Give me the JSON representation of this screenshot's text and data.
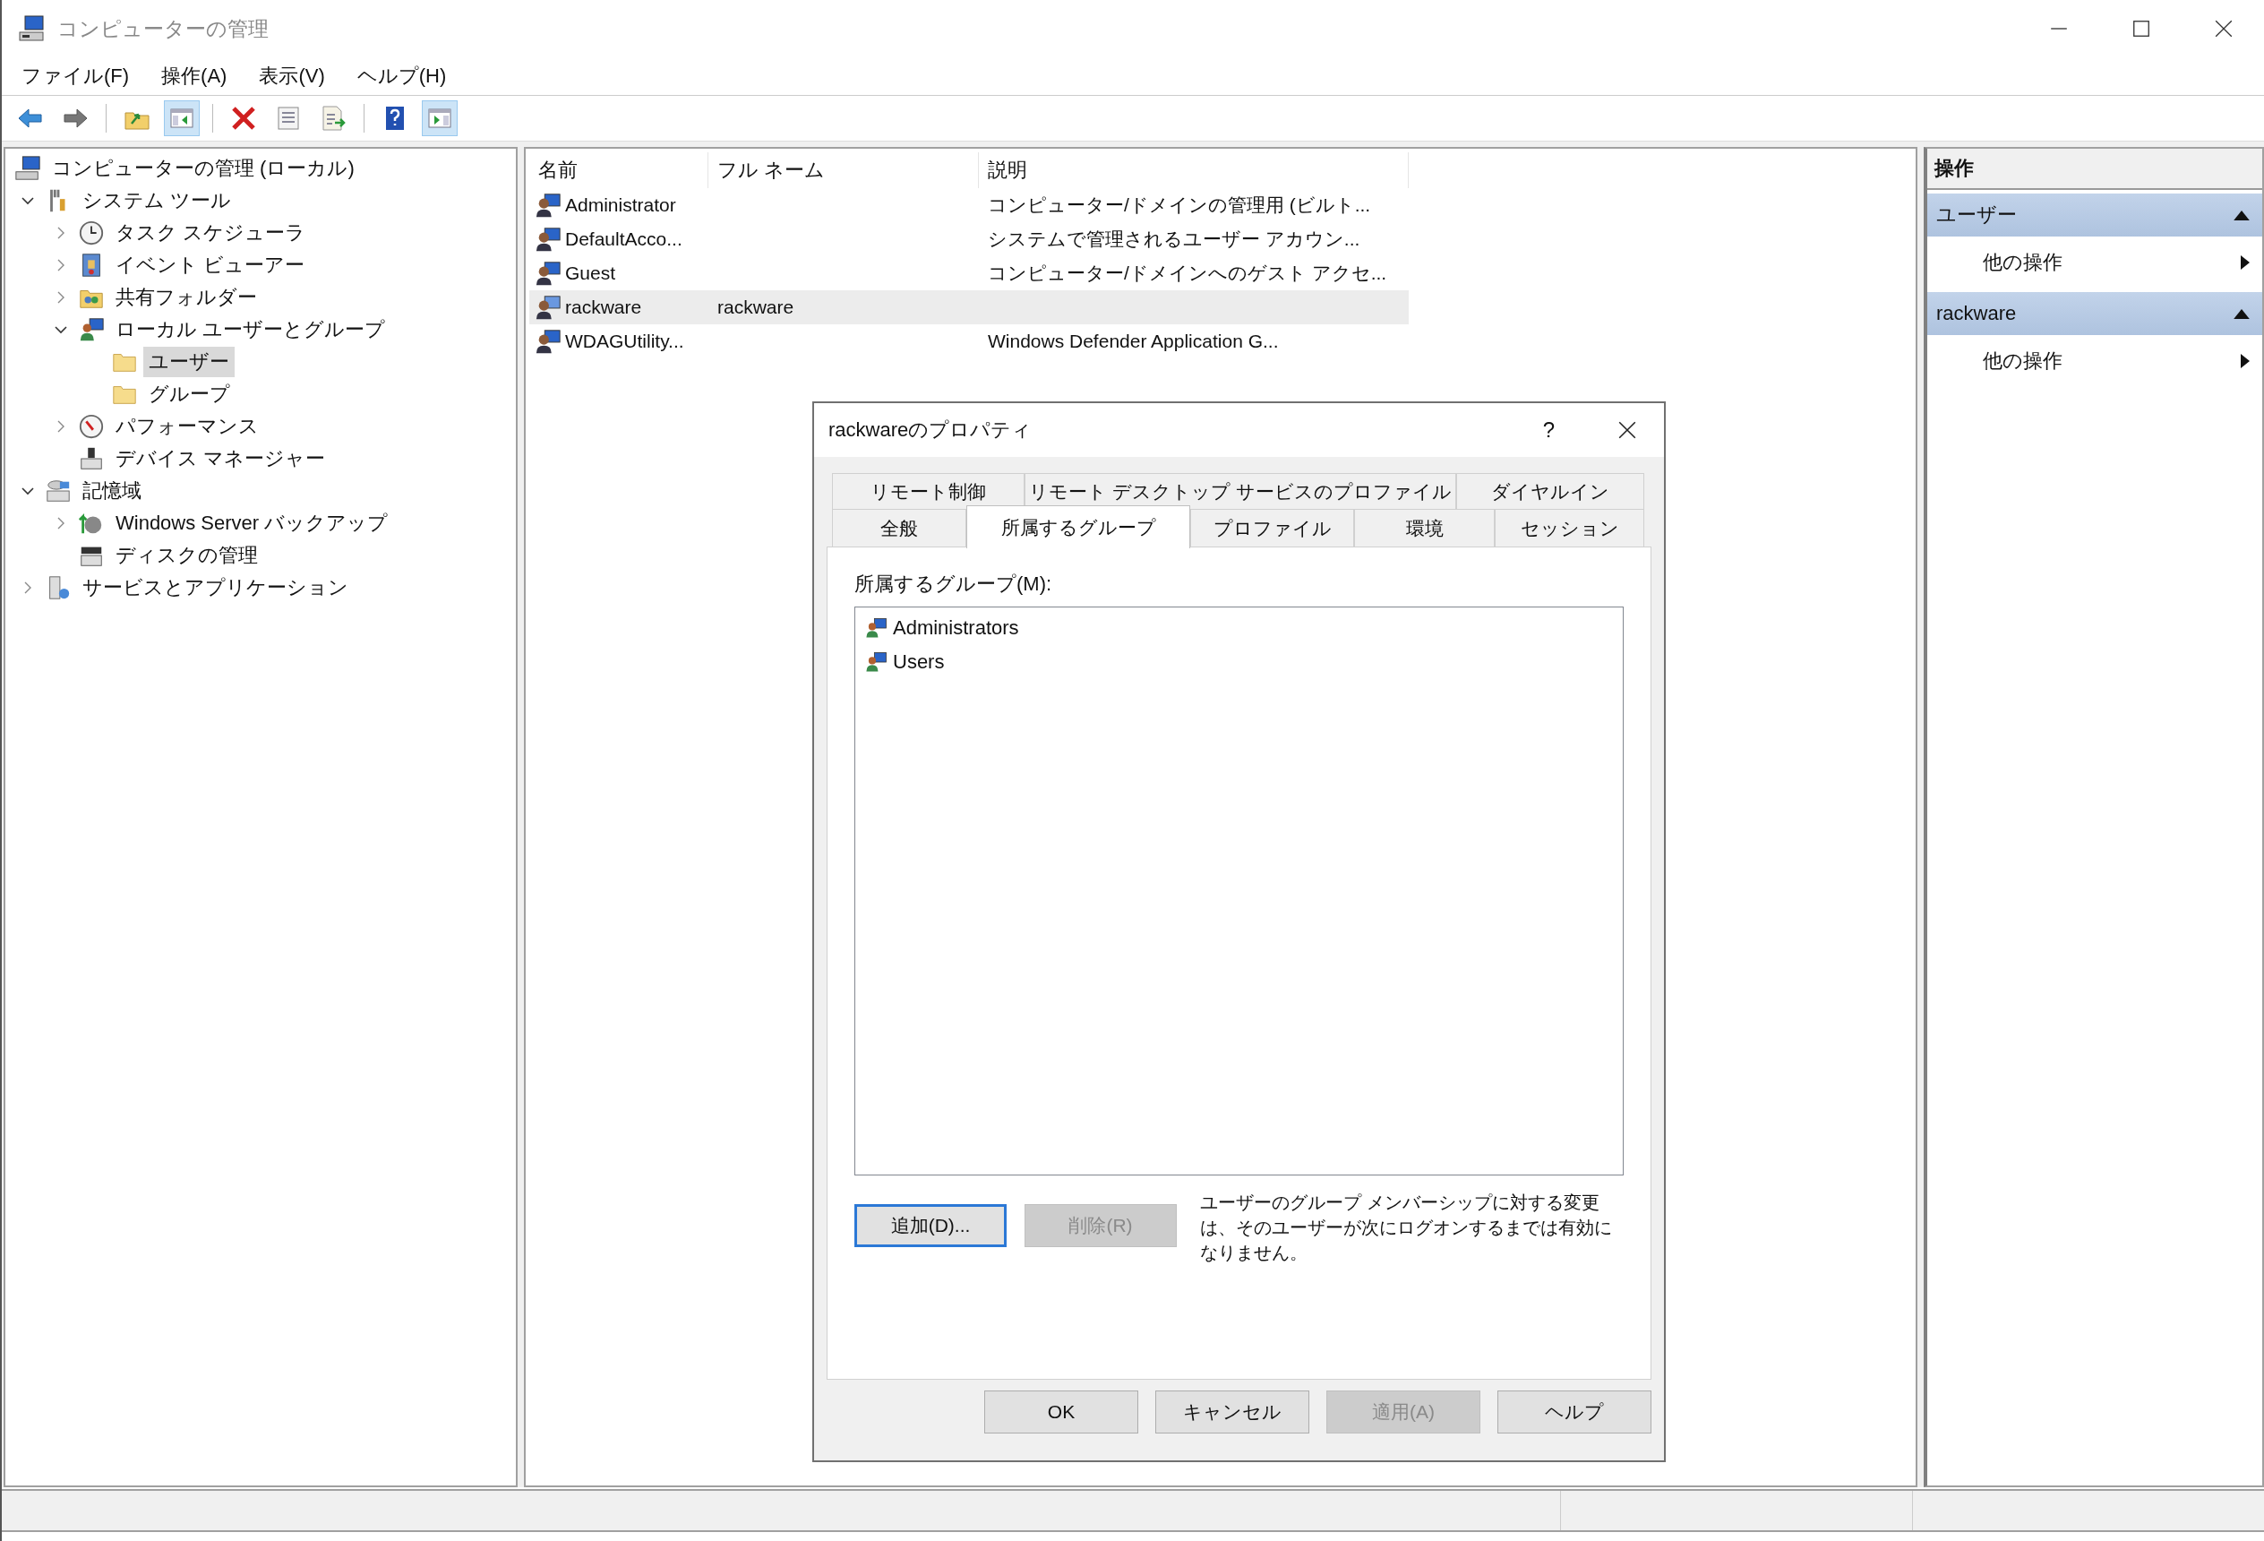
{
  "window": {
    "title": "コンピューターの管理"
  },
  "menu": [
    "ファイル(F)",
    "操作(A)",
    "表示(V)",
    "ヘルプ(H)"
  ],
  "toolbar": [
    {
      "pressed": false
    },
    {
      "pressed": false
    },
    {
      "pressed": false
    },
    {
      "pressed": true
    },
    {
      "pressed": false
    },
    {
      "pressed": false
    },
    {
      "pressed": false
    },
    {
      "pressed": false
    },
    {
      "pressed": true
    }
  ],
  "tree": {
    "items": [
      {
        "label": "コンピューターの管理 (ローカル)",
        "selected": false,
        "children": [
          {
            "label": "システム ツール",
            "expanded": true,
            "selected": false,
            "children": [
              {
                "label": "タスク スケジューラ",
                "expanded": false,
                "selected": false
              },
              {
                "label": "イベント ビューアー",
                "expanded": false,
                "selected": false
              },
              {
                "label": "共有フォルダー",
                "expanded": false,
                "selected": false
              },
              {
                "label": "ローカル ユーザーとグループ",
                "expanded": true,
                "selected": false,
                "children": [
                  {
                    "label": "ユーザー",
                    "selected": true
                  },
                  {
                    "label": "グループ",
                    "selected": false
                  }
                ]
              },
              {
                "label": "パフォーマンス",
                "expanded": false,
                "selected": false
              },
              {
                "label": "デバイス マネージャー",
                "selected": false
              }
            ]
          },
          {
            "label": "記憶域",
            "expanded": true,
            "selected": false,
            "children": [
              {
                "label": "Windows Server バックアップ",
                "expanded": false,
                "selected": false
              },
              {
                "label": "ディスクの管理",
                "selected": false
              }
            ]
          },
          {
            "label": "サービスとアプリケーション",
            "expanded": false,
            "selected": false
          }
        ]
      }
    ]
  },
  "users": {
    "columns": [
      "名前",
      "フル ネーム",
      "説明"
    ],
    "rows": [
      {
        "name": "Administrator",
        "full_name": "",
        "description": "コンピューター/ドメインの管理用 (ビルト...",
        "selected": false
      },
      {
        "name": "DefaultAcco...",
        "full_name": "",
        "description": "システムで管理されるユーザー アカウン...",
        "selected": false
      },
      {
        "name": "Guest",
        "full_name": "",
        "description": "コンピューター/ドメインへのゲスト アクセ...",
        "selected": false
      },
      {
        "name": "rackware",
        "full_name": "rackware",
        "description": "",
        "selected": true
      },
      {
        "name": "WDAGUtility...",
        "full_name": "",
        "description": "Windows Defender Application G...",
        "selected": false
      }
    ]
  },
  "actions": {
    "title": "操作",
    "sections": [
      {
        "header": "ユーザー",
        "expanded": true,
        "items": [
          "他の操作"
        ]
      },
      {
        "header": "rackware",
        "expanded": true,
        "items": [
          "他の操作"
        ]
      }
    ]
  },
  "dialog": {
    "title": "rackwareのプロパティ",
    "help": "?",
    "tab_rows": [
      [
        {
          "label": "リモート制御",
          "selected": false
        },
        {
          "label": "リモート デスクトップ サービスのプロファイル",
          "selected": false
        },
        {
          "label": "ダイヤルイン",
          "selected": false
        }
      ],
      [
        {
          "label": "全般",
          "selected": false
        },
        {
          "label": "所属するグループ",
          "selected": true
        },
        {
          "label": "プロファイル",
          "selected": false
        },
        {
          "label": "環境",
          "selected": false
        },
        {
          "label": "セッション",
          "selected": false
        }
      ]
    ],
    "groups_label": "所属するグループ(M):",
    "groups": [
      "Administrators",
      "Users"
    ],
    "add_button": {
      "label": "追加(D)...",
      "disabled": false,
      "focused": true
    },
    "remove_button": {
      "label": "削除(R)",
      "disabled": true,
      "focused": false
    },
    "note": "ユーザーのグループ メンバーシップに対する変更は、そのユーザーが次にログオンするまでは有効になりません。",
    "buttons": [
      {
        "label": "OK",
        "disabled": false
      },
      {
        "label": "キャンセル",
        "disabled": false
      },
      {
        "label": "適用(A)",
        "disabled": true
      },
      {
        "label": "ヘルプ",
        "disabled": false
      }
    ]
  }
}
